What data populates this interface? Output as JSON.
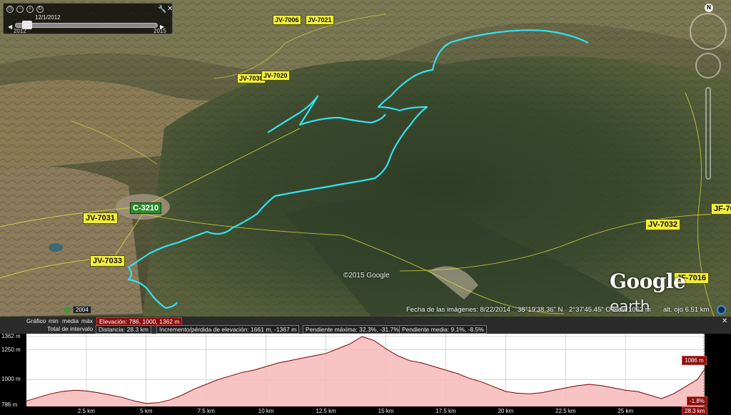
{
  "time_slider": {
    "date": "12/1/2012",
    "start_year": "2012",
    "end_year": "2015"
  },
  "map": {
    "road_labels": [
      {
        "text": "JV-7006",
        "size": "sm"
      },
      {
        "text": "JV-7021",
        "size": "sm"
      },
      {
        "text": "JV-7030",
        "size": "sm"
      },
      {
        "text": "JV-7020",
        "size": "sm"
      },
      {
        "text": "C-3210",
        "size": "lg",
        "color": "green"
      },
      {
        "text": "JV-7031",
        "size": "lg"
      },
      {
        "text": "JV-7033",
        "size": "lg"
      },
      {
        "text": "JV-7032",
        "size": "lg"
      },
      {
        "text": "JF-70",
        "size": "lg"
      },
      {
        "text": "JF-7016",
        "size": "lg"
      }
    ],
    "copyright": "©2015 Google",
    "logo_main": "Google",
    "logo_sub": "earth",
    "compass_letter": "N",
    "track_color": "#33e0f0"
  },
  "status_bar": {
    "historical_year": "2004",
    "imagery_date": "Fecha de las imágenes: 8/22/2014",
    "latitude": "38°19'38.36\" N",
    "longitude": "2°37'45.45\" O",
    "elevation": "elev.  1052 m",
    "eye_altitude": "alt. ojo    6.51 km"
  },
  "profile": {
    "header": {
      "chart_label": "Gráfico",
      "min_label": "min",
      "mean_label": "media",
      "max_label": "máx",
      "elevation_stat": "Elevación: 786, 1000, 1362 m",
      "total_label": "Total de intervalo",
      "distance_stat": "Distancia: 28.3 km",
      "gain_loss_stat": "Incremento/pérdida de elevación:  1661 m, -1367 m",
      "max_slope_stat": "Pendiente máxima:  32.3%, -31.7%",
      "mean_slope_stat": "Pendiente media:  9.1%, -8.5%"
    },
    "cursor_elevation": "1086 m",
    "cursor_slope": "-1.8%",
    "cursor_distance": "28.3 km"
  },
  "chart_data": {
    "type": "area",
    "xlabel": "",
    "ylabel": "",
    "x_unit": "km",
    "y_unit": "m",
    "ylim": [
      786,
      1362
    ],
    "xlim": [
      0,
      28.3
    ],
    "y_ticks": [
      "1362 m",
      "1250 m",
      "1000 m",
      "786 m"
    ],
    "y_tick_values": [
      1362,
      1250,
      1000,
      786
    ],
    "x_ticks": [
      "2.5 km",
      "5 km",
      "7.5 km",
      "10 km",
      "12.5 km",
      "15 km",
      "17.5 km",
      "20 km",
      "22.5 km",
      "25 km"
    ],
    "x_tick_values": [
      2.5,
      5,
      7.5,
      10,
      12.5,
      15,
      17.5,
      20,
      22.5,
      25
    ],
    "x": [
      0,
      0.5,
      1,
      1.5,
      2,
      2.5,
      3,
      3.5,
      4,
      4.5,
      5,
      5.5,
      6,
      6.5,
      7,
      7.5,
      8,
      8.5,
      9,
      9.5,
      10,
      10.5,
      11,
      11.5,
      12,
      12.5,
      13,
      13.5,
      14,
      14.5,
      15,
      15.5,
      16,
      16.5,
      17,
      17.5,
      18,
      18.5,
      19,
      19.5,
      20,
      20.5,
      21,
      21.5,
      22,
      22.5,
      23,
      23.5,
      24,
      24.5,
      25,
      25.5,
      26,
      26.5,
      27,
      27.5,
      28,
      28.3
    ],
    "y": [
      820,
      850,
      880,
      900,
      910,
      905,
      890,
      870,
      850,
      820,
      800,
      805,
      830,
      870,
      920,
      960,
      1000,
      1030,
      1060,
      1080,
      1110,
      1140,
      1160,
      1180,
      1200,
      1220,
      1260,
      1300,
      1362,
      1330,
      1260,
      1200,
      1160,
      1140,
      1110,
      1080,
      1050,
      1010,
      980,
      940,
      900,
      885,
      880,
      890,
      910,
      930,
      950,
      960,
      950,
      930,
      910,
      900,
      870,
      840,
      880,
      940,
      1000,
      1086
    ],
    "fill_color": "#f6b8b8",
    "line_color": "#7a0000"
  }
}
